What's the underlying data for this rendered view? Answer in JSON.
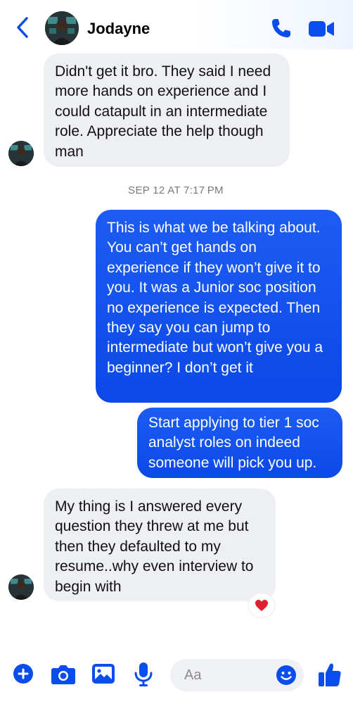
{
  "header": {
    "contact_name": "Jodayne"
  },
  "messages": [
    {
      "direction": "incoming",
      "text": "Didn't get it bro. They said I need more hands on experience and I could catapult in an intermediate role.  Appreciate the help though man"
    },
    {
      "direction": "outgoing",
      "text": "This is what we be talking about. You can’t get hands on experience if they won’t give it to you. It was a Junior soc position no experience is expected. Then they say you can jump to intermediate but won’t give you a beginner? I don’t get it"
    },
    {
      "direction": "outgoing",
      "text": "Start applying to tier 1 soc analyst roles on indeed someone will pick you up."
    },
    {
      "direction": "incoming",
      "text": "My thing is I answered every question they threw at me but then they defaulted to my resume..why even interview to begin with"
    }
  ],
  "timestamp": "SEP 12 AT 7:17 PM",
  "reaction": {
    "icon": "heart",
    "color": "#e0202a"
  },
  "composer": {
    "placeholder": "Aa"
  },
  "colors": {
    "accent": "#0a4ded",
    "incoming_bubble": "#eeeff2",
    "outgoing_bubble": "#0b49e8"
  }
}
